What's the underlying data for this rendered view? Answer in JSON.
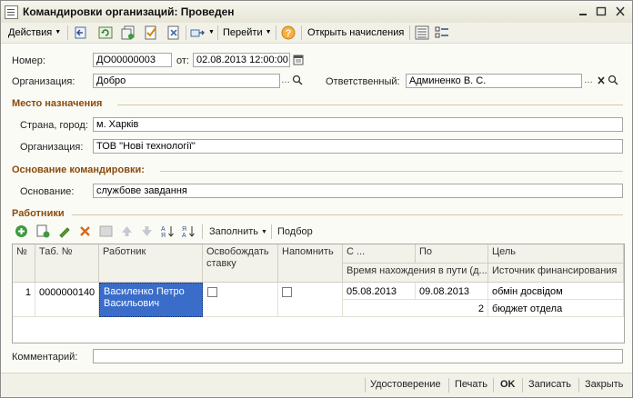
{
  "window": {
    "title": "Командировки организаций: Проведен"
  },
  "toolbar": {
    "actions_label": "Действия",
    "goto_label": "Перейти",
    "open_accruals_label": "Открыть начисления"
  },
  "header": {
    "number_label": "Номер:",
    "number_value": "ДО00000003",
    "from_label": "от:",
    "date_value": "02.08.2013 12:00:00",
    "organization_label": "Организация:",
    "organization_value": "Добро",
    "responsible_label": "Ответственный:",
    "responsible_value": "Админенко В. С."
  },
  "destination": {
    "section_title": "Место назначения",
    "country_city_label": "Страна, город:",
    "country_city_value": "м. Харків",
    "organization_label": "Организация:",
    "organization_value": "ТОВ \"Нові технології\""
  },
  "basis": {
    "section_title": "Основание командировки:",
    "basis_label": "Основание:",
    "basis_value": "службове завдання"
  },
  "workers": {
    "section_title": "Работники",
    "fill_label": "Заполнить",
    "select_label": "Подбор",
    "columns": {
      "no": "№",
      "tab_no": "Таб. №",
      "worker": "Работник",
      "release_rate": "Освобождать ставку",
      "remind": "Напомнить",
      "from": "С ...",
      "to": "По",
      "goal": "Цель",
      "time_in_transit": "Время нахождения в пути (д...",
      "funding_source": "Источник финансирования"
    },
    "rows": [
      {
        "no": "1",
        "tab_no": "0000000140",
        "worker": "Василенко Петро Васильович",
        "release_rate": false,
        "remind": false,
        "from": "05.08.2013",
        "to": "09.08.2013",
        "goal": "обмін досвідом",
        "time_in_transit": "2",
        "funding_source": "бюджет отдела"
      }
    ]
  },
  "comment": {
    "label": "Комментарий:",
    "value": ""
  },
  "footer": {
    "certificate_label": "Удостоверение",
    "print_label": "Печать",
    "ok_label": "OK",
    "save_label": "Записать",
    "close_label": "Закрыть"
  },
  "colors": {
    "section_title": "#8a4b0c",
    "selected_cell": "#3a6cc9"
  }
}
